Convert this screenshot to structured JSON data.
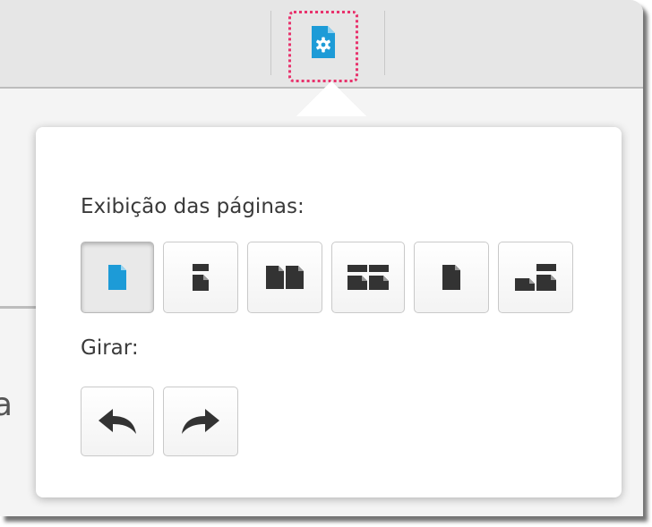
{
  "toolbar": {
    "settings_icon": "document-gear-icon"
  },
  "popover": {
    "view_label": "Exibição das páginas:",
    "rotate_label": "Girar:",
    "view_modes": [
      {
        "name": "single-page",
        "icon": "single-page-icon",
        "selected": true
      },
      {
        "name": "continuous-page",
        "icon": "continuous-page-icon",
        "selected": false
      },
      {
        "name": "facing-pages",
        "icon": "facing-pages-icon",
        "selected": false
      },
      {
        "name": "facing-continuous",
        "icon": "facing-continuous-icon",
        "selected": false
      },
      {
        "name": "cover-page",
        "icon": "cover-page-icon",
        "selected": false
      },
      {
        "name": "cover-continuous",
        "icon": "cover-continuous-icon",
        "selected": false
      }
    ],
    "rotate_buttons": [
      {
        "name": "rotate-left",
        "icon": "rotate-left-arrow-icon"
      },
      {
        "name": "rotate-right",
        "icon": "rotate-right-arrow-icon"
      }
    ]
  },
  "background_text": "a",
  "colors": {
    "accent": "#1d9bd7",
    "highlight_border": "#e8336d",
    "icon_dark": "#333333",
    "toolbar_bg": "#e6e6e6"
  }
}
